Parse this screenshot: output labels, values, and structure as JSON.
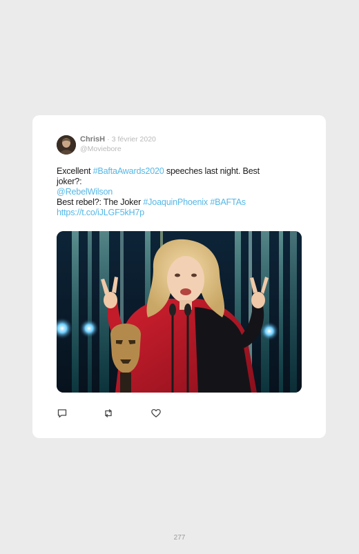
{
  "tweet": {
    "author_name": "ChrisH",
    "separator": "·",
    "date": "3 février 2020",
    "handle": "@Moviebore",
    "text": {
      "line1_pre": "Excellent ",
      "line1_hashtag": "#BaftaAwards2020",
      "line1_post": " speeches last night. Best",
      "line2": "joker?:",
      "line3_mention": "@RebelWilson",
      "line4_pre": "Best rebel?: The Joker ",
      "line4_hashtag1": "#JoaquinPhoenix",
      "line4_space": " ",
      "line4_hashtag2": "#BAFTAs",
      "line5_link": "https://t.co/iJLGF5kH7p"
    },
    "actions": {
      "reply_icon": "reply-icon",
      "retweet_icon": "retweet-icon",
      "like_icon": "heart-icon"
    }
  },
  "page": {
    "number": "277"
  },
  "colors": {
    "link": "#54b7e6",
    "card": "#ffffff",
    "background": "#ebebeb"
  }
}
